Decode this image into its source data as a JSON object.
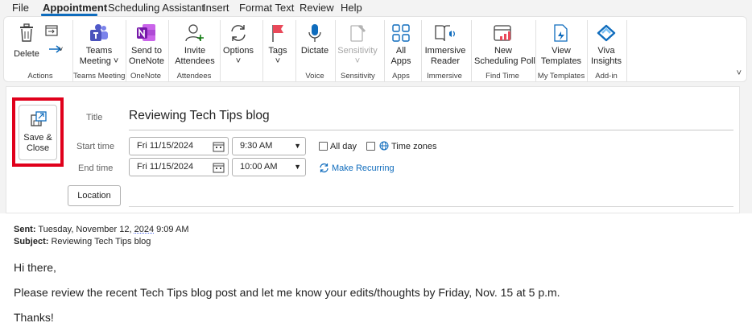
{
  "menu": [
    "File",
    "Appointment",
    "Scheduling Assistant",
    "Insert",
    "Format Text",
    "Review",
    "Help"
  ],
  "ribbon": {
    "delete": "Delete",
    "teams_meeting": [
      "Teams",
      "Meeting ˅"
    ],
    "send_onenote": [
      "Send to",
      "OneNote"
    ],
    "invite_attendees": [
      "Invite",
      "Attendees"
    ],
    "options": "Options",
    "tags": "Tags",
    "dictate": "Dictate",
    "sensitivity": "Sensitivity",
    "all_apps": [
      "All",
      "Apps"
    ],
    "immersive_reader": [
      "Immersive",
      "Reader"
    ],
    "new_poll": [
      "New",
      "Scheduling Poll"
    ],
    "view_templates": [
      "View",
      "Templates"
    ],
    "viva_insights": [
      "Viva",
      "Insights"
    ],
    "groups": [
      "Actions",
      "Teams Meeting",
      "OneNote",
      "Attendees",
      "Voice",
      "Sensitivity",
      "Apps",
      "Immersive",
      "Find Time",
      "My Templates",
      "Add-in"
    ],
    "chevron": "˅",
    "dropdown_marker": "˅"
  },
  "form": {
    "save_close": [
      "Save &",
      "Close"
    ],
    "title_label": "Title",
    "title_value": "Reviewing Tech Tips blog",
    "start_label": "Start time",
    "start_date": "Fri 11/15/2024",
    "start_time": "9:30 AM",
    "end_label": "End time",
    "end_date": "Fri 11/15/2024",
    "end_time": "10:00 AM",
    "all_day": "All day",
    "time_zones": "Time zones",
    "make_recurring": "Make Recurring",
    "location": "Location",
    "dropdown_arrow": "▼"
  },
  "body": {
    "sent_label": "Sent:",
    "sent_value_a": " Tuesday, November 12, ",
    "sent_value_year": "2024",
    "sent_value_b": " 9:09 AM",
    "subject_label": "Subject:",
    "subject_value": " Reviewing Tech Tips blog",
    "greeting": "Hi there,",
    "message": "Please review the recent Tech Tips blog post and let me know your edits/thoughts by Friday, Nov. 15 at 5 p.m.",
    "closing": "Thanks!"
  }
}
